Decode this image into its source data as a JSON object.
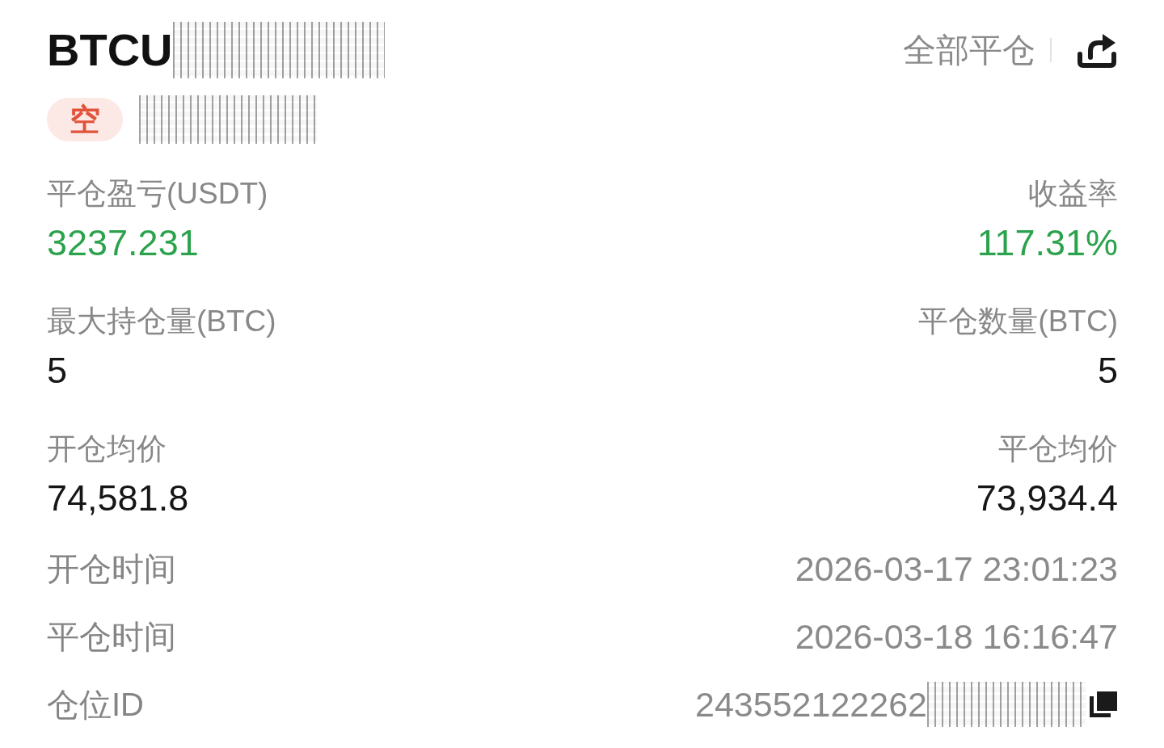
{
  "header": {
    "title": "BTCU",
    "action": "全部平仓"
  },
  "side_badge": {
    "label": "空",
    "kind": "short"
  },
  "stats": [
    {
      "label": "平仓盈亏(USDT)",
      "value": "3237.231",
      "kind": "gain"
    },
    {
      "label": "收益率",
      "value": "117.31%",
      "kind": "gain"
    },
    {
      "label": "最大持仓量(BTC)",
      "value": "5",
      "kind": "plain"
    },
    {
      "label": "平仓数量(BTC)",
      "value": "5",
      "kind": "plain"
    },
    {
      "label": "开仓均价",
      "value": "74,581.8",
      "kind": "plain"
    },
    {
      "label": "平仓均价",
      "value": "73,934.4",
      "kind": "plain"
    }
  ],
  "details": [
    {
      "label": "开仓时间",
      "value": "2026-03-17 23:01:23",
      "copyable": false
    },
    {
      "label": "平仓时间",
      "value": "2026-03-18 16:16:47",
      "copyable": false
    },
    {
      "label": "仓位ID",
      "value": "243552122262",
      "copyable": true
    }
  ]
}
